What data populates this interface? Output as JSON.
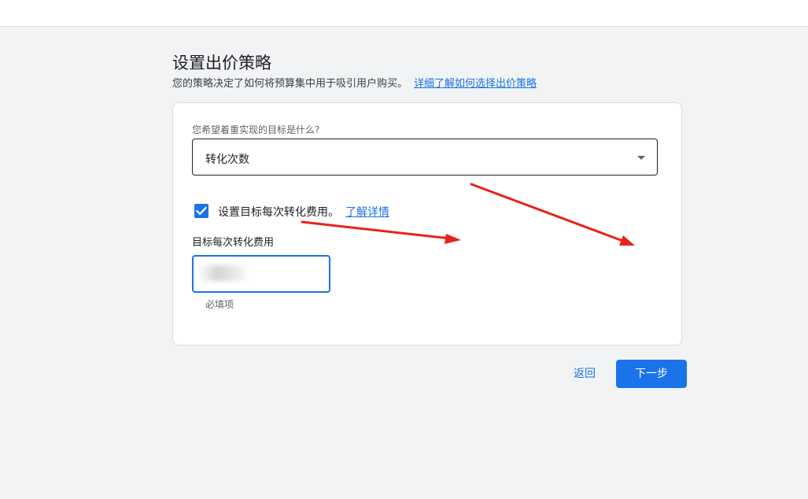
{
  "page": {
    "title": "设置出价策略",
    "subtitle": "您的策略决定了如何将预算集中用于吸引用户购买。",
    "subtitle_link": "详细了解如何选择出价策略"
  },
  "form": {
    "goal_question": "您希望着重实现的目标是什么?",
    "goal_value": "转化次数",
    "checkbox_checked": true,
    "checkbox_label": "设置目标每次转化费用。",
    "checkbox_link": "了解详情",
    "field_label": "目标每次转化费用",
    "field_helper": "必填项"
  },
  "actions": {
    "back_label": "返回",
    "next_label": "下一步"
  },
  "colors": {
    "accent": "#1a73e8",
    "background": "#f1f3f4",
    "annotation_arrow": "#e8231c"
  },
  "icons": {
    "dropdown": "dropdown-caret-icon",
    "checkbox": "checkmark-icon",
    "annotation": "red-arrow-icon"
  }
}
